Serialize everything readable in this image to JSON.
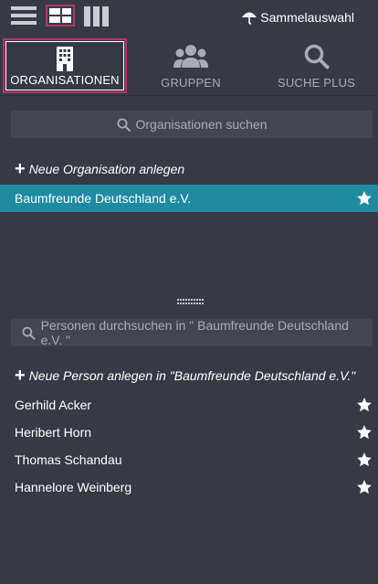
{
  "toolbar": {
    "sammel_label": "Sammelauswahl"
  },
  "tabs": [
    {
      "label": "ORGANISATIONEN",
      "icon": "building-icon",
      "active": true
    },
    {
      "label": "GRUPPEN",
      "icon": "users-icon",
      "active": false
    },
    {
      "label": "SUCHE PLUS",
      "icon": "search-icon",
      "active": false
    }
  ],
  "org_search": {
    "placeholder": "Organisationen suchen"
  },
  "new_org": {
    "label": "Neue Organisation anlegen"
  },
  "organisations": [
    {
      "name": "Baumfreunde Deutschland e.V.",
      "selected": true,
      "favorite": true
    }
  ],
  "person_search": {
    "placeholder": "Personen durchsuchen in \" Baumfreunde Deutschland e.V. \""
  },
  "new_person": {
    "label": "Neue Person anlegen in \"Baumfreunde Deutschland e.V.\""
  },
  "persons": [
    {
      "name": "Gerhild Acker",
      "favorite": true
    },
    {
      "name": "Heribert Horn",
      "favorite": true
    },
    {
      "name": "Thomas Schandau",
      "favorite": true
    },
    {
      "name": "Hannelore Weinberg",
      "favorite": true
    }
  ],
  "colors": {
    "background": "#353a47",
    "accent": "#b8336a",
    "selected": "#1f8ba3",
    "input": "#414653"
  }
}
